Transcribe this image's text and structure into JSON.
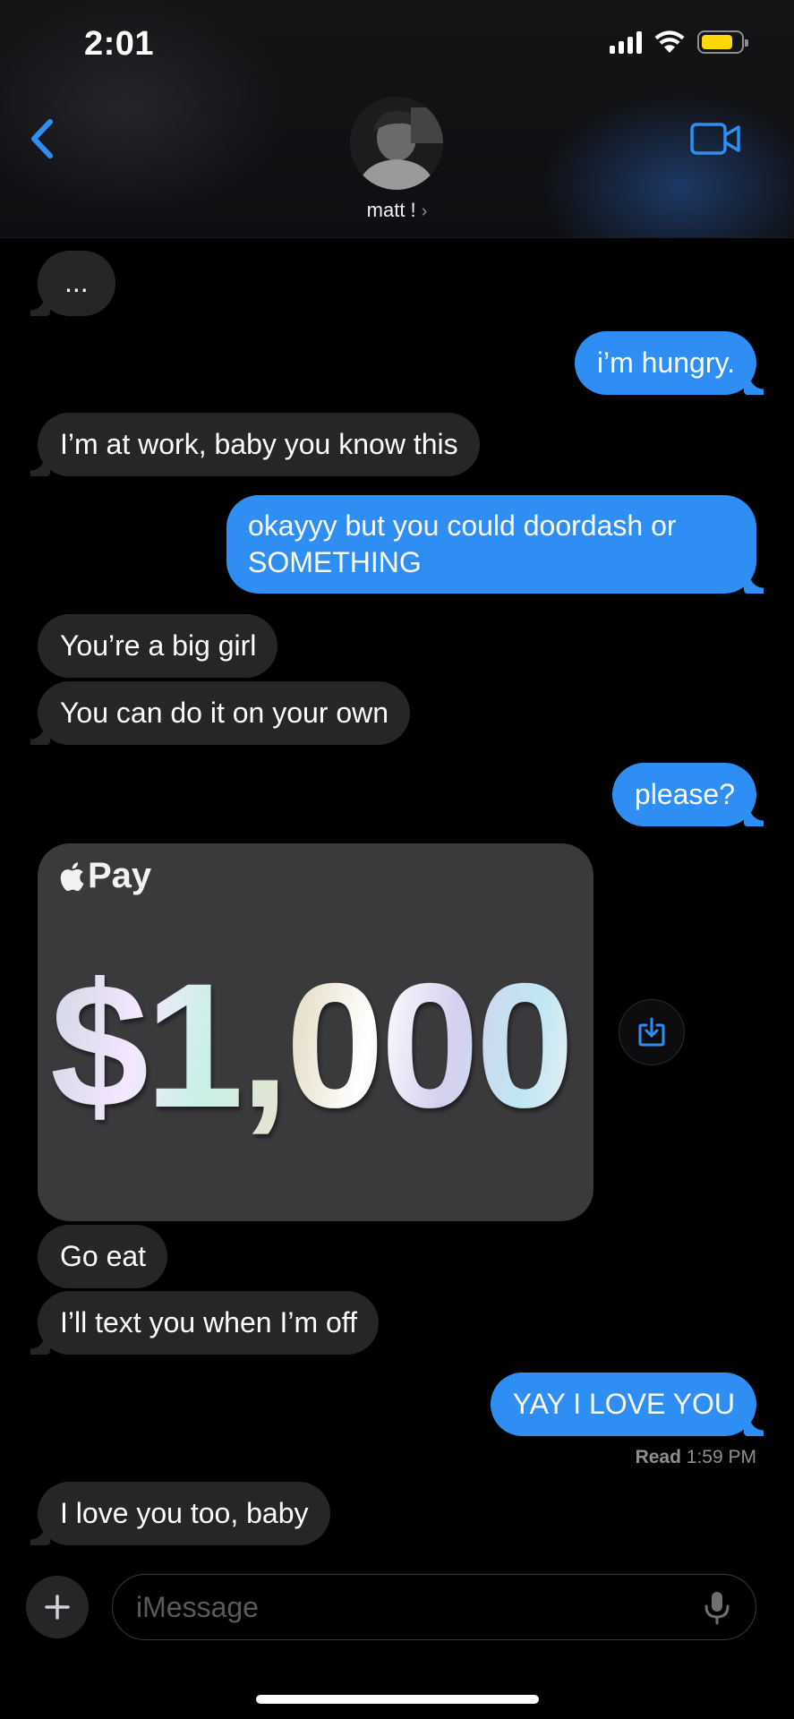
{
  "status_bar": {
    "time": "2:01",
    "battery_level": 0.8,
    "battery_color": "#ffd60a"
  },
  "header": {
    "contact_name": "matt !",
    "chevron": "›",
    "back_icon": "chevron-left-icon",
    "video_icon": "video-camera-icon",
    "accent_color": "#2f8ef4"
  },
  "messages": [
    {
      "dir": "received",
      "text": "..."
    },
    {
      "dir": "sent",
      "text": "i’m hungry."
    },
    {
      "dir": "received",
      "text": "I’m at work, baby you know this"
    },
    {
      "dir": "sent",
      "text": "okayyy but you could doordash or SOMETHING"
    },
    {
      "dir": "received",
      "text": "You’re a big girl"
    },
    {
      "dir": "received",
      "text": "You can do it on your own"
    },
    {
      "dir": "sent",
      "text": "please?"
    },
    {
      "dir": "received",
      "text": "Go eat"
    },
    {
      "dir": "received",
      "text": "I’ll text you when I’m off"
    },
    {
      "dir": "sent",
      "text": "YAY I LOVE YOU"
    },
    {
      "dir": "received",
      "text": "I love you too, baby"
    }
  ],
  "apple_pay": {
    "logo_text": "Pay",
    "amount": "$1,000",
    "save_icon": "save-to-wallet-icon"
  },
  "read_receipt": {
    "label": "Read",
    "time": "1:59 PM"
  },
  "composer": {
    "placeholder": "iMessage",
    "plus_icon": "plus-icon",
    "mic_icon": "microphone-icon"
  },
  "colors": {
    "sent_bubble": "#2f8ef4",
    "received_bubble": "#262628",
    "background": "#000000"
  }
}
